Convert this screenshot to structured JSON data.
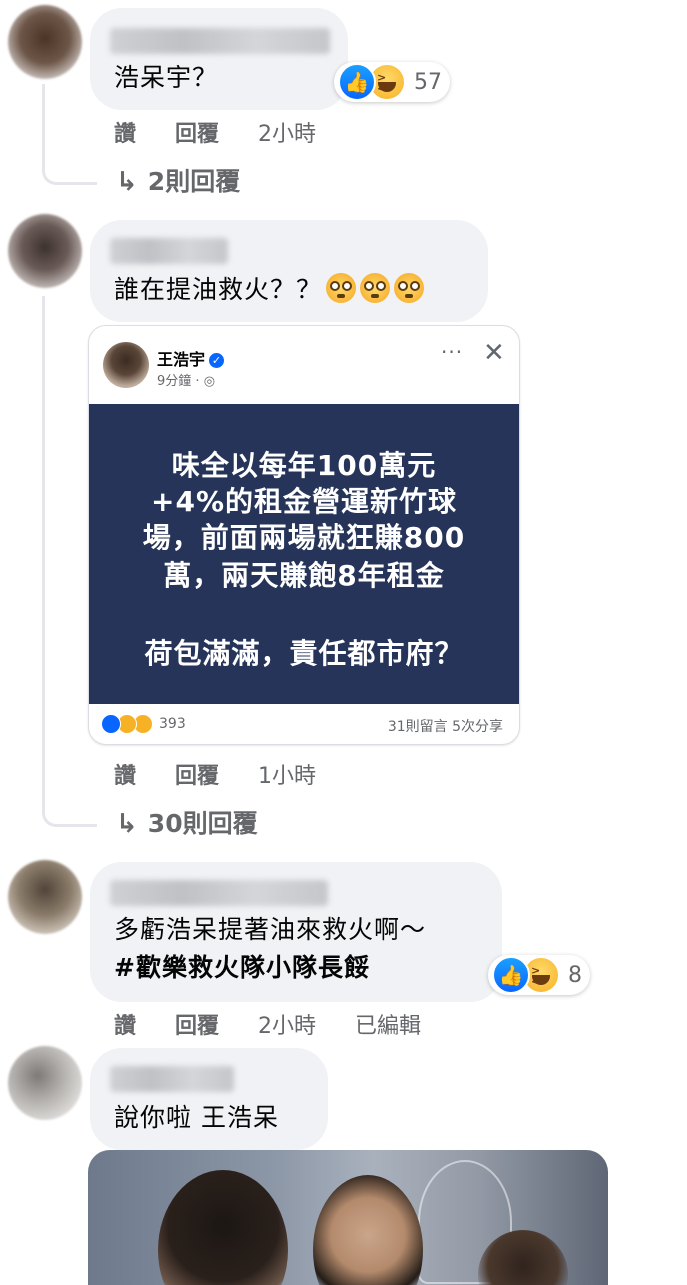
{
  "comments": [
    {
      "text": "浩呆宇？",
      "reactions": {
        "count": "57",
        "icons": [
          "like-icon",
          "haha-icon"
        ]
      },
      "actions": {
        "like": "讚",
        "reply": "回覆",
        "time": "2小時"
      },
      "replies_label": "2則回覆"
    },
    {
      "text": "誰在提油救火？？",
      "emoji": [
        "flushed-face",
        "flushed-face",
        "flushed-face"
      ],
      "shared_post": {
        "author": "王浩宇",
        "time": "9分鐘",
        "dots": "···",
        "close": "✕",
        "image_lines": [
          "味全以每年100萬元",
          "+4%的租金營運新竹球",
          "場，前面兩場就狂賺800",
          "萬，兩天賺飽8年租金",
          "荷包滿滿，責任都市府？"
        ],
        "reaction_count": "393",
        "comments_shares": "31則留言  5次分享"
      },
      "actions": {
        "like": "讚",
        "reply": "回覆",
        "time": "1小時"
      },
      "replies_label": "30則回覆"
    },
    {
      "line1": "多虧浩呆提著油來救火啊～",
      "line2": "#歡樂救火隊小隊長餒",
      "reactions": {
        "count": "8",
        "icons": [
          "like-icon",
          "haha-icon"
        ]
      },
      "actions": {
        "like": "讚",
        "reply": "回覆",
        "time": "2小時",
        "edited": "已編輯"
      }
    },
    {
      "text": "說你啦 王浩呆"
    }
  ],
  "colors": {
    "bubble": "#f0f2f5",
    "meta": "#65676b",
    "link_blue": "#0866ff",
    "card_bg": "#253458"
  }
}
